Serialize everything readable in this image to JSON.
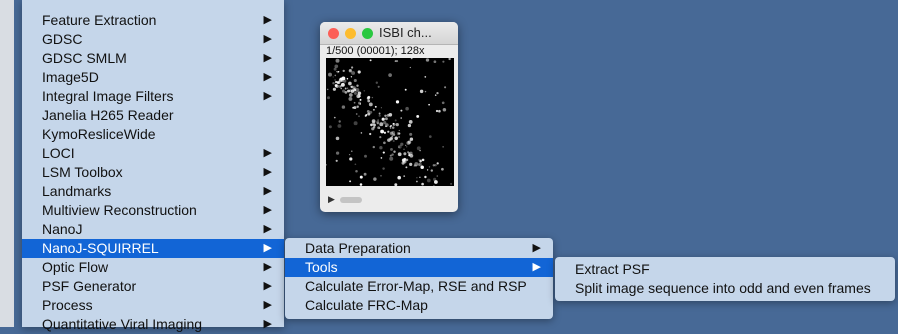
{
  "menu_level1": {
    "items": [
      {
        "label": "Feature Extraction",
        "submenu": true
      },
      {
        "label": "GDSC",
        "submenu": true
      },
      {
        "label": "GDSC SMLM",
        "submenu": true
      },
      {
        "label": "Image5D",
        "submenu": true
      },
      {
        "label": "Integral Image Filters",
        "submenu": true
      },
      {
        "label": "Janelia H265 Reader",
        "submenu": false
      },
      {
        "label": "KymoResliceWide",
        "submenu": false
      },
      {
        "label": "LOCI",
        "submenu": true
      },
      {
        "label": "LSM Toolbox",
        "submenu": true
      },
      {
        "label": "Landmarks",
        "submenu": true
      },
      {
        "label": "Multiview Reconstruction",
        "submenu": true
      },
      {
        "label": "NanoJ",
        "submenu": true
      },
      {
        "label": "NanoJ-SQUIRREL",
        "submenu": true,
        "selected": true
      },
      {
        "label": "Optic Flow",
        "submenu": true
      },
      {
        "label": "PSF Generator",
        "submenu": true
      },
      {
        "label": "Process",
        "submenu": true
      },
      {
        "label": "Quantitative Viral Imaging",
        "submenu": true
      }
    ]
  },
  "menu_level2": {
    "items": [
      {
        "label": "Data Preparation",
        "submenu": true
      },
      {
        "label": "Tools",
        "submenu": true,
        "selected": true
      },
      {
        "label": "Calculate Error-Map, RSE and RSP",
        "submenu": false
      },
      {
        "label": "Calculate FRC-Map",
        "submenu": false
      }
    ]
  },
  "menu_level3": {
    "items": [
      {
        "label": "Extract PSF"
      },
      {
        "label": "Split image sequence into odd and even frames"
      }
    ]
  },
  "image_window": {
    "title": "ISBI ch...",
    "frame_info": "1/500 (00001); 128x"
  },
  "glyphs": {
    "submenu_arrow": "▶",
    "play": "▶"
  },
  "colors": {
    "desktop": "#476996",
    "menu_bg": "#c5d6ea",
    "selection": "#1265d6"
  }
}
